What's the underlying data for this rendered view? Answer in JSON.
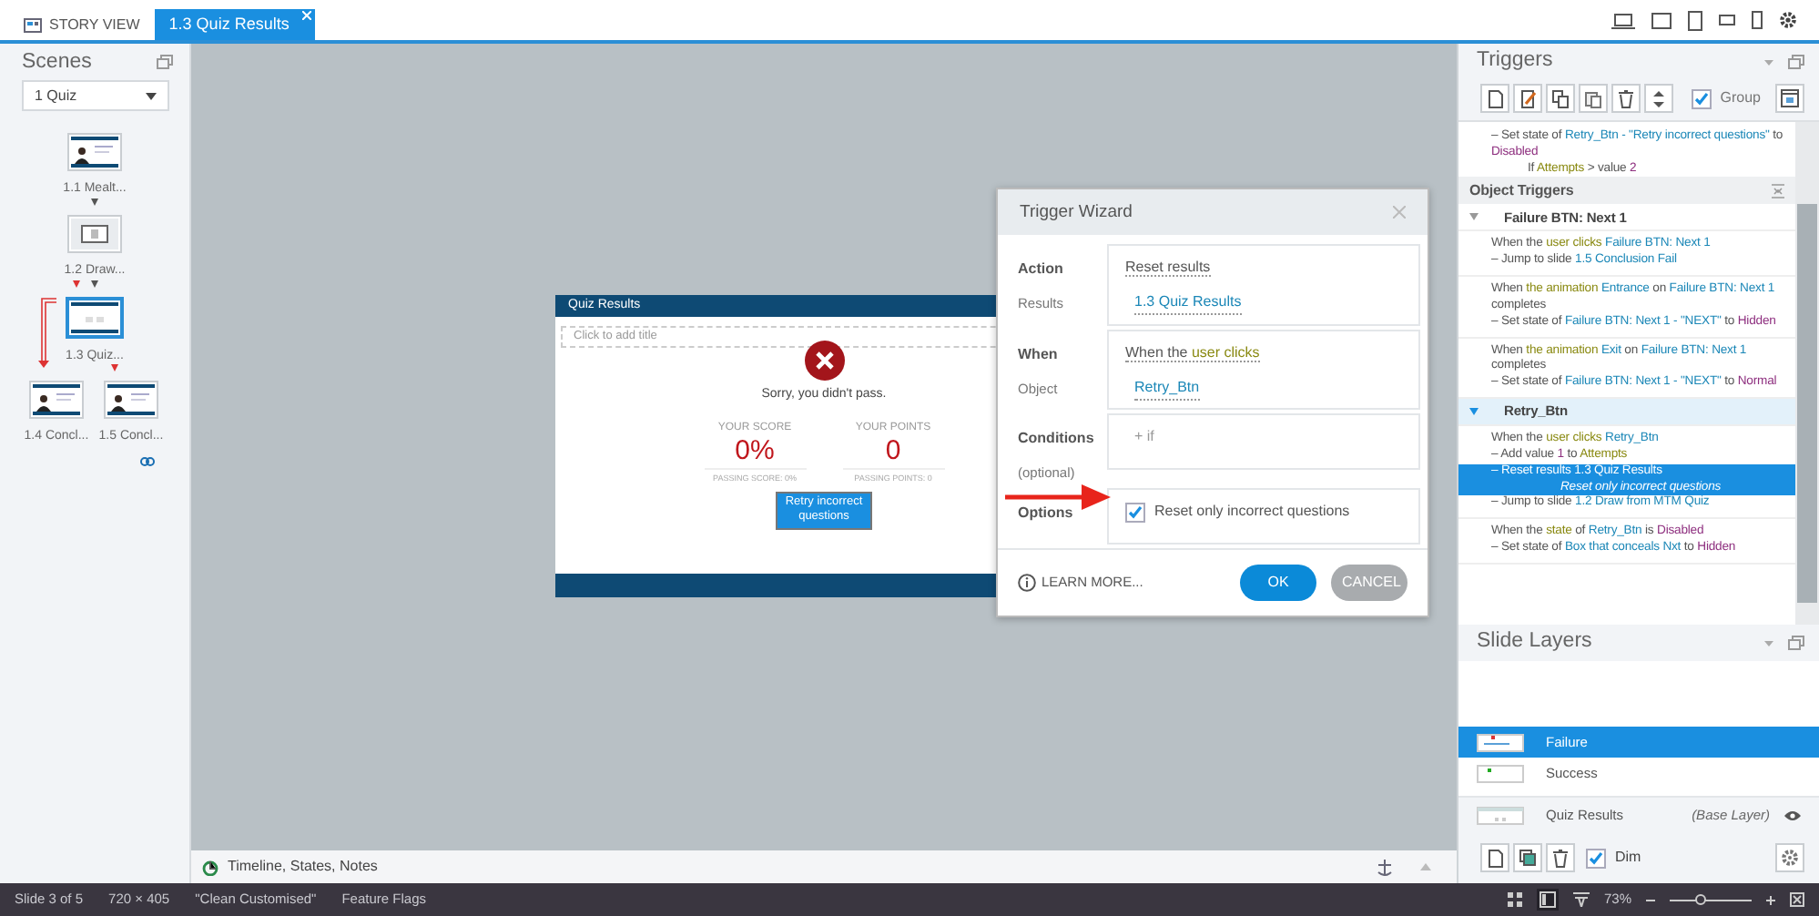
{
  "tabs": [
    {
      "label": "STORY VIEW",
      "kind": "story",
      "selected": false
    },
    {
      "label": "1.3 Quiz Results",
      "kind": "slide",
      "selected": true
    }
  ],
  "scenes": {
    "title": "Scenes",
    "dropdown": "1 Quiz",
    "slides": [
      {
        "label": "1.1 Mealt...",
        "selected": false
      },
      {
        "label": "1.2 Draw...",
        "selected": false
      },
      {
        "label": "1.3 Quiz...",
        "selected": true
      },
      {
        "label": "1.4 Concl...",
        "selected": false
      },
      {
        "label": "1.5 Concl...",
        "selected": false
      }
    ]
  },
  "slide": {
    "title": "Quiz Results",
    "placeholder": "Click to add title",
    "message": "Sorry, you didn't pass.",
    "scores": [
      {
        "label": "YOUR SCORE",
        "value": "0%",
        "passing": "PASSING SCORE: 0%"
      },
      {
        "label": "YOUR POINTS",
        "value": "0",
        "passing": "PASSING POINTS: 0"
      }
    ],
    "button": "Retry incorrect questions"
  },
  "trigger_wizard": {
    "title": "Trigger Wizard",
    "rows": [
      {
        "kind": "link",
        "label": "Action",
        "sublabel": "Results",
        "value": "Reset results",
        "link": "1.3 Quiz Results"
      },
      {
        "kind": "when",
        "label": "When",
        "sublabel": "Object",
        "parts": [
          {
            "t": "When the ",
            "kind": "plain"
          },
          {
            "t": "user clicks",
            "kind": "event"
          }
        ],
        "link": "Retry_Btn"
      },
      {
        "kind": "condition",
        "label": "Conditions",
        "sublabel": "(optional)",
        "value": "+ if"
      },
      {
        "kind": "option",
        "label": "Options",
        "option": "Reset only incorrect questions",
        "checked": true
      }
    ],
    "learn_more": "LEARN MORE...",
    "buttons": [
      {
        "label": "OK",
        "kind": "primary"
      },
      {
        "label": "CANCEL",
        "kind": "secondary"
      }
    ]
  },
  "timeline": "Timeline, States, Notes",
  "triggers": {
    "title": "Triggers",
    "group": {
      "label": "Group",
      "checked": true
    },
    "slide_actions": [
      {
        "parts": [
          {
            "t": "– Set state of ",
            "kind": "plain"
          },
          {
            "t": "Retry_Btn - \"Retry incorrect questions\"",
            "kind": "object"
          },
          {
            "t": " to ",
            "kind": "plain"
          },
          {
            "t": "Disabled",
            "kind": "value"
          }
        ],
        "selected": false,
        "conditions": [
          {
            "parts": [
              {
                "t": "If ",
                "kind": "plain"
              },
              {
                "t": "Attempts",
                "kind": "event"
              },
              {
                "t": " > value ",
                "kind": "plain"
              },
              {
                "t": "2",
                "kind": "value"
              }
            ]
          }
        ]
      }
    ],
    "section": "Object Triggers",
    "groups": [
      {
        "name": "Failure BTN: Next 1",
        "expanded": true,
        "selected": false,
        "triggers": [
          {
            "when": [
              {
                "t": "When the ",
                "kind": "plain"
              },
              {
                "t": "user clicks ",
                "kind": "event"
              },
              {
                "t": "Failure BTN: Next 1",
                "kind": "object"
              }
            ],
            "actions": [
              {
                "parts": [
                  {
                    "t": "– Jump to slide ",
                    "kind": "plain"
                  },
                  {
                    "t": "1.5 Conclusion Fail",
                    "kind": "object"
                  }
                ],
                "selected": false
              }
            ]
          },
          {
            "when": [
              {
                "t": "When ",
                "kind": "plain"
              },
              {
                "t": "the animation ",
                "kind": "event"
              },
              {
                "t": "Entrance",
                "kind": "object"
              },
              {
                "t": " on ",
                "kind": "plain"
              },
              {
                "t": "Failure BTN: Next 1",
                "kind": "object"
              },
              {
                "t": " completes",
                "kind": "plain"
              }
            ],
            "actions": [
              {
                "parts": [
                  {
                    "t": "– Set state of ",
                    "kind": "plain"
                  },
                  {
                    "t": "Failure BTN: Next 1 - \"NEXT\"",
                    "kind": "object"
                  },
                  {
                    "t": " to ",
                    "kind": "plain"
                  },
                  {
                    "t": "Hidden",
                    "kind": "value"
                  }
                ],
                "selected": false
              }
            ]
          },
          {
            "when": [
              {
                "t": "When ",
                "kind": "plain"
              },
              {
                "t": "the animation ",
                "kind": "event"
              },
              {
                "t": "Exit",
                "kind": "object"
              },
              {
                "t": " on ",
                "kind": "plain"
              },
              {
                "t": "Failure BTN: Next 1",
                "kind": "object"
              },
              {
                "t": " completes",
                "kind": "plain"
              }
            ],
            "actions": [
              {
                "parts": [
                  {
                    "t": "– Set state of ",
                    "kind": "plain"
                  },
                  {
                    "t": "Failure BTN: Next 1 - \"NEXT\"",
                    "kind": "object"
                  },
                  {
                    "t": " to ",
                    "kind": "plain"
                  },
                  {
                    "t": "Normal",
                    "kind": "value"
                  }
                ],
                "selected": false
              }
            ]
          }
        ]
      },
      {
        "name": "Retry_Btn",
        "expanded": true,
        "selected": true,
        "triggers": [
          {
            "when": [
              {
                "t": "When the ",
                "kind": "plain"
              },
              {
                "t": "user clicks ",
                "kind": "event"
              },
              {
                "t": "Retry_Btn",
                "kind": "object"
              }
            ],
            "actions": [
              {
                "parts": [
                  {
                    "t": "– Add value ",
                    "kind": "plain"
                  },
                  {
                    "t": "1",
                    "kind": "value"
                  },
                  {
                    "t": " to ",
                    "kind": "plain"
                  },
                  {
                    "t": "Attempts",
                    "kind": "event"
                  }
                ],
                "selected": false
              },
              {
                "parts": [
                  {
                    "t": "– Reset results ",
                    "kind": "plain"
                  },
                  {
                    "t": "1.3 Quiz Results",
                    "kind": "object"
                  }
                ],
                "note": "Reset only incorrect questions",
                "selected": true
              },
              {
                "parts": [
                  {
                    "t": "– Jump to slide ",
                    "kind": "plain"
                  },
                  {
                    "t": "1.2 Draw from MTM Quiz",
                    "kind": "object"
                  }
                ],
                "selected": false
              }
            ]
          },
          {
            "when": [
              {
                "t": "When the ",
                "kind": "plain"
              },
              {
                "t": "state",
                "kind": "event"
              },
              {
                "t": " of ",
                "kind": "plain"
              },
              {
                "t": "Retry_Btn",
                "kind": "object"
              },
              {
                "t": " is ",
                "kind": "plain"
              },
              {
                "t": "Disabled",
                "kind": "value"
              }
            ],
            "actions": [
              {
                "parts": [
                  {
                    "t": "– Set state of ",
                    "kind": "plain"
                  },
                  {
                    "t": "Box that conceals Nxt",
                    "kind": "object"
                  },
                  {
                    "t": " to ",
                    "kind": "plain"
                  },
                  {
                    "t": "Hidden",
                    "kind": "value"
                  }
                ],
                "selected": false
              }
            ]
          }
        ]
      }
    ]
  },
  "slide_layers": {
    "title": "Slide Layers",
    "layers": [
      {
        "name": "Failure",
        "selected": true
      },
      {
        "name": "Success",
        "selected": false
      },
      {
        "name": "Quiz Results",
        "note": "(Base Layer)",
        "selected": false
      }
    ],
    "dim": {
      "label": "Dim",
      "checked": true
    }
  },
  "status_bar": {
    "items": [
      "Slide 3 of 5",
      "720 × 405",
      "\"Clean Customised\"",
      "Feature Flags"
    ],
    "zoom": "73%",
    "zoom_slider": {
      "level": 0.37
    }
  }
}
